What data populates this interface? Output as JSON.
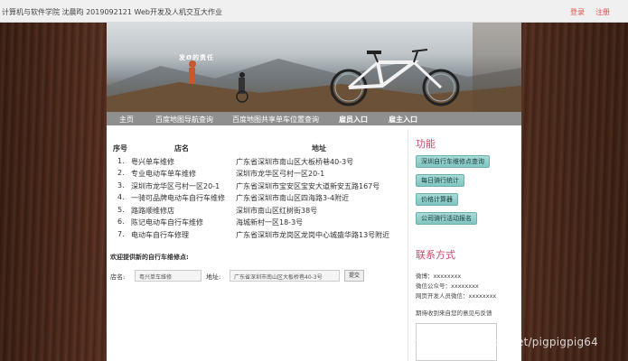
{
  "topbar": {
    "info": "计算机与软件学院  沈晨昀  2019092121  Web开发及人机交互大作业",
    "login": "登录",
    "register": "注册"
  },
  "banner": {
    "slogan": "发Ø的责任"
  },
  "nav": {
    "items": [
      "主页",
      "百度地图导航查询",
      "百度地图共享单车位置查询",
      "雇员入口",
      "雇主入口"
    ]
  },
  "table": {
    "headers": [
      "序号",
      "店名",
      "地址"
    ],
    "rows": [
      {
        "no": "1.",
        "name": "粤兴单车维修",
        "addr": "广东省深圳市南山区大板桥巷40-3号"
      },
      {
        "no": "2.",
        "name": "专业电动车单车维修",
        "addr": "深圳市龙华区弓村一区20-1"
      },
      {
        "no": "3.",
        "name": "深圳市龙华区弓村一区20-1",
        "addr": "广东省深圳市宝安区宝安大道新安五路167号"
      },
      {
        "no": "4.",
        "name": "一骑可品牌电动车自行车维修",
        "addr": "广东省深圳市南山区四海路3-4附近"
      },
      {
        "no": "5.",
        "name": "路路顺维修店",
        "addr": "深圳市南山区红树街38号"
      },
      {
        "no": "6.",
        "name": "陈记电动车自行车维修",
        "addr": "海城新村一区18-3号"
      },
      {
        "no": "7.",
        "name": "电动车自行车修理",
        "addr": "广东省深圳市龙岗区龙岗中心城盛华路13号附近"
      }
    ]
  },
  "form": {
    "title": "欢迎提供新的自行车维修点:",
    "name_label": "店名:",
    "name_value": "粤兴单车维修",
    "addr_label": "地址:",
    "addr_value": "广东省深圳市南山区大板桥巷40-3号",
    "submit": "提交"
  },
  "side": {
    "func_title": "功能",
    "buttons": [
      "深圳自行车维修点查询",
      "每日骑行统计",
      "价格计算器",
      "公司骑行活动报名"
    ],
    "contact_title": "联系方式",
    "weibo": "微博：xxxxxxxx",
    "wechat": "微信公众号：xxxxxxxx",
    "dev_wechat": "网页开发人员微信：xxxxxxxx",
    "feedback_prompt": "期待收到来自您的意见与反馈"
  },
  "watermark": "https://blog.csdn.net/pigpigpig64",
  "colors": {
    "accent": "#c94a6b",
    "link": "#d9534f",
    "nav_bg": "#8f8f8f",
    "func_button": "#8fd0cc"
  }
}
